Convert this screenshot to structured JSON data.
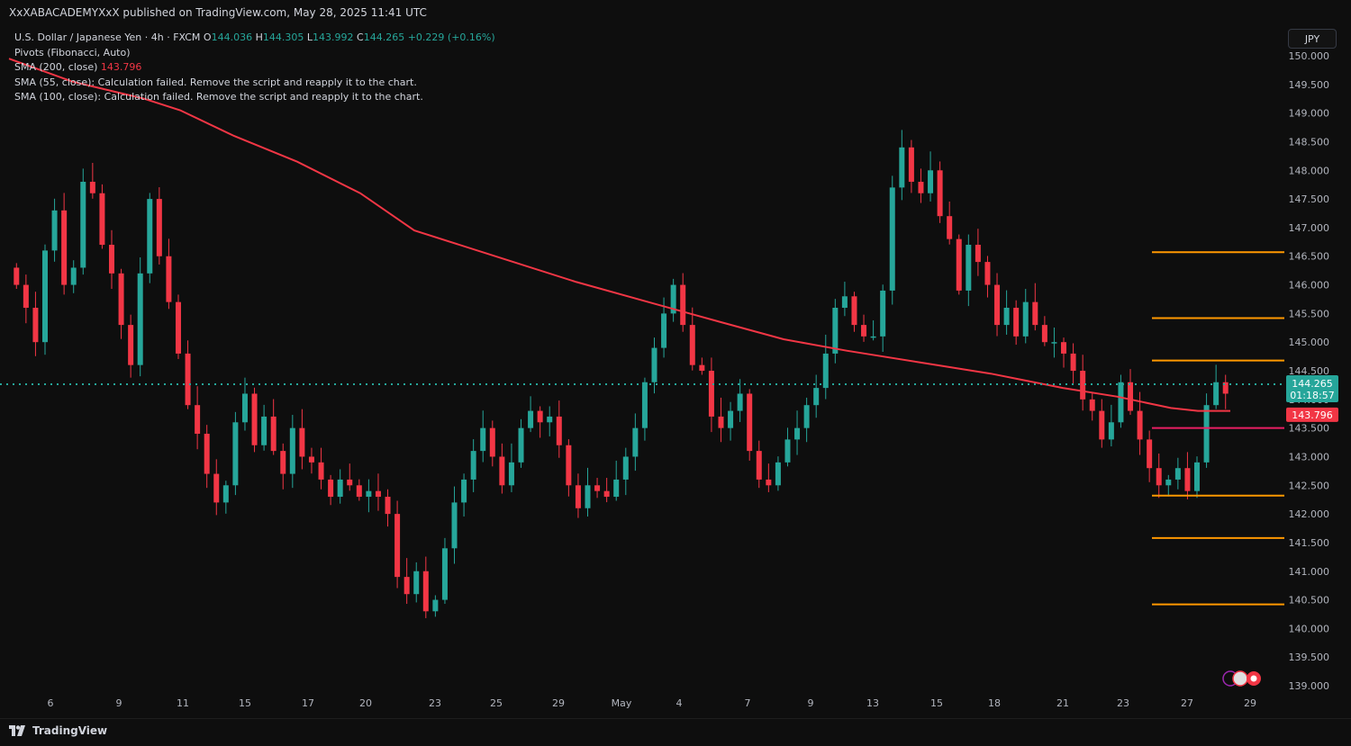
{
  "header": {
    "publish_line": "XxXABACADEMYXxX published on TradingView.com, May 28, 2025 11:41 UTC"
  },
  "legend": {
    "symbol_line_prefix": "U.S. Dollar / Japanese Yen · 4h · FXCM",
    "open_label": "O",
    "open": "144.036",
    "high_label": "H",
    "high": "144.305",
    "low_label": "L",
    "low": "143.992",
    "close_label": "C",
    "close": "144.265",
    "change": "+0.229 (+0.16%)",
    "pivots": "Pivots (Fibonacci, Auto)",
    "sma200_label": "SMA (200, close)",
    "sma200_value": "143.796",
    "sma55": "SMA (55, close): Calculation failed. Remove the script and reapply it to the chart.",
    "sma100": "SMA (100, close): Calculation failed. Remove the script and reapply it to the chart."
  },
  "currency_button": "JPY",
  "footer": {
    "brand": "TradingView"
  },
  "colors": {
    "up": "#26a69a",
    "down": "#f23645",
    "sma": "#f23645",
    "pivot": "#ff9800",
    "pivot_p": "#e91e63",
    "price_line": "#26a69a",
    "background": "#0e0e0e",
    "axis_text": "#b2b5be"
  },
  "chart_data": {
    "type": "candlestick",
    "symbol": "USDJPY",
    "timeframe": "4h",
    "ylim": [
      138.9,
      150.3
    ],
    "y_ticks": [
      "150.000",
      "149.500",
      "149.000",
      "148.500",
      "148.000",
      "147.500",
      "147.000",
      "146.500",
      "146.000",
      "145.500",
      "145.000",
      "144.500",
      "144.000",
      "143.500",
      "143.000",
      "142.500",
      "142.000",
      "141.500",
      "141.000",
      "140.500",
      "140.000",
      "139.500",
      "139.000"
    ],
    "x_ticks": [
      "6",
      "9",
      "11",
      "15",
      "17",
      "20",
      "23",
      "25",
      "29",
      "May",
      "4",
      "7",
      "9",
      "13",
      "15",
      "18",
      "21",
      "23",
      "27",
      "29"
    ],
    "last_price": "144.265",
    "countdown": "01:18:57",
    "sma_price": "143.796",
    "pivot_levels": [
      {
        "name": "R3",
        "value": 146.57,
        "color": "#ff9800"
      },
      {
        "name": "R2",
        "value": 145.42,
        "color": "#ff9800"
      },
      {
        "name": "R1",
        "value": 144.68,
        "color": "#ff9800"
      },
      {
        "name": "P",
        "value": 143.5,
        "color": "#e91e63"
      },
      {
        "name": "S1",
        "value": 142.32,
        "color": "#ff9800"
      },
      {
        "name": "S2",
        "value": 141.58,
        "color": "#ff9800"
      },
      {
        "name": "S3",
        "value": 140.42,
        "color": "#ff9800"
      }
    ],
    "close_path": [
      146.0,
      145.6,
      145.0,
      146.6,
      147.3,
      146.0,
      146.3,
      147.8,
      147.6,
      146.7,
      146.2,
      145.3,
      144.6,
      146.2,
      147.5,
      146.5,
      145.7,
      144.8,
      143.9,
      143.4,
      142.7,
      142.2,
      142.5,
      143.6,
      144.1,
      143.2,
      143.7,
      143.1,
      142.7,
      143.5,
      143.0,
      142.9,
      142.6,
      142.3,
      142.6,
      142.5,
      142.3,
      142.4,
      142.3,
      142.0,
      140.9,
      140.6,
      141.0,
      140.3,
      140.5,
      141.4,
      142.2,
      142.6,
      143.1,
      143.5,
      143.0,
      142.5,
      142.9,
      143.5,
      143.8,
      143.6,
      143.7,
      143.2,
      142.5,
      142.1,
      142.5,
      142.4,
      142.3,
      142.6,
      143.0,
      143.5,
      144.3,
      144.9,
      145.5,
      146.0,
      145.3,
      144.6,
      144.5,
      143.7,
      143.5,
      143.8,
      144.1,
      143.1,
      142.6,
      142.5,
      142.9,
      143.3,
      143.5,
      143.9,
      144.2,
      144.8,
      145.6,
      145.8,
      145.3,
      145.1,
      145.1,
      145.9,
      147.7,
      148.4,
      147.8,
      147.6,
      148.0,
      147.2,
      146.8,
      145.9,
      146.7,
      146.4,
      146.0,
      145.3,
      145.6,
      145.1,
      145.7,
      145.3,
      145.0,
      145.0,
      144.8,
      144.5,
      144.0,
      143.8,
      143.3,
      143.6,
      144.3,
      143.8,
      143.3,
      142.8,
      142.5,
      142.6,
      142.8,
      142.4,
      142.9,
      143.9,
      144.3,
      144.1
    ]
  }
}
